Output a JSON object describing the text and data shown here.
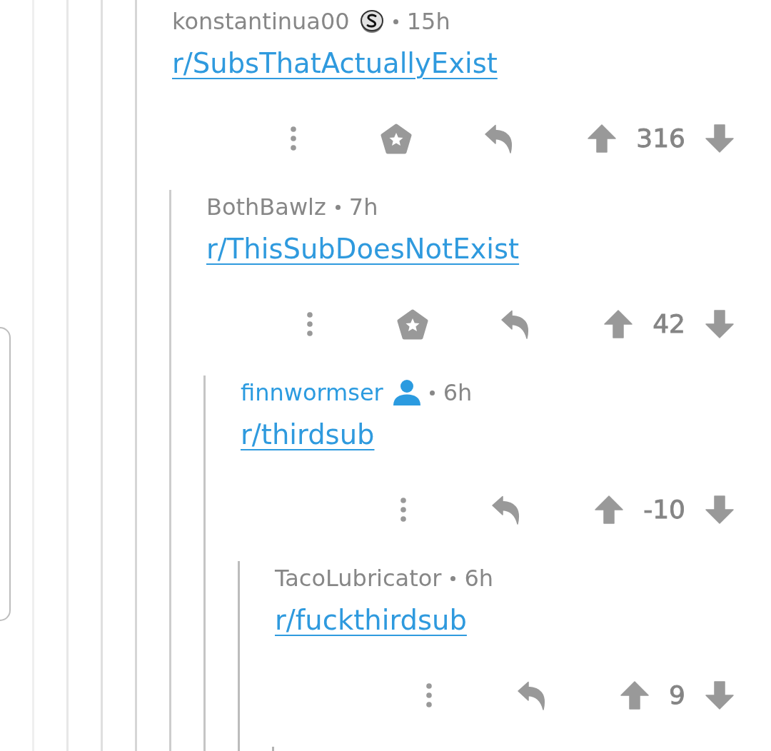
{
  "comments": [
    {
      "author": "konstantinua00",
      "submitter": false,
      "flair": true,
      "age": "15h",
      "body_link": "r/SubsThatActuallyExist",
      "awardable": true,
      "score": "316",
      "more_replies": false,
      "children": [
        {
          "author": "BothBawlz",
          "submitter": false,
          "flair": false,
          "age": "7h",
          "body_link": "r/ThisSubDoesNotExist",
          "awardable": true,
          "score": "42",
          "more_replies": false,
          "children": [
            {
              "author": "finnwormser",
              "submitter": true,
              "flair": false,
              "age": "6h",
              "body_link": "r/thirdsub",
              "awardable": false,
              "score": "-10",
              "more_replies": false,
              "children": [
                {
                  "author": "TacoLubricator",
                  "submitter": false,
                  "flair": false,
                  "age": "6h",
                  "body_link": "r/fuckthirdsub",
                  "awardable": false,
                  "score": "9",
                  "more_replies": true
                }
              ]
            }
          ]
        }
      ]
    }
  ]
}
